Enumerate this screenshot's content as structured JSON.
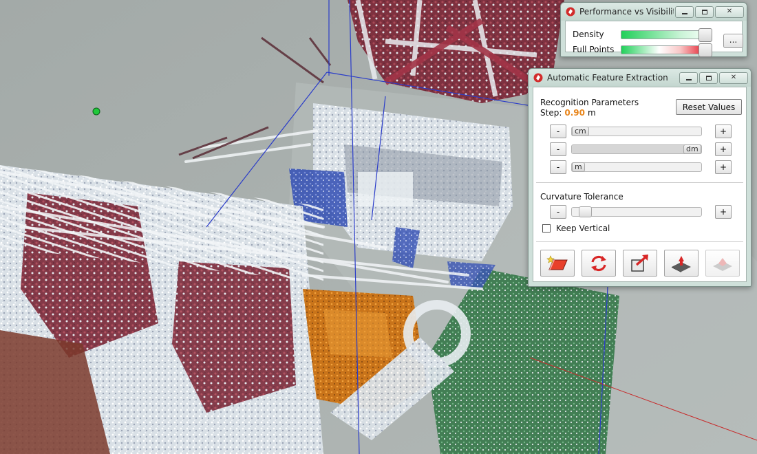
{
  "scene": {
    "description_icons": [
      "point-cloud-scan"
    ]
  },
  "perf_window": {
    "title": "Performance vs Visibility",
    "density_label": "Density",
    "density_level": 1.0,
    "full_points_label": "Full Points",
    "full_points_level": 1.0,
    "more_label": "..."
  },
  "afe_window": {
    "title": "Automatic Feature Extraction",
    "recognition_title": "Recognition Parameters",
    "step_label": "Step:",
    "step_value": "0.90",
    "step_unit": "m",
    "reset_label": "Reset Values",
    "minus_label": "-",
    "plus_label": "+",
    "sliders": [
      {
        "unit": "cm",
        "level": 0.0
      },
      {
        "unit": "dm",
        "level": 1.0
      },
      {
        "unit": "m",
        "level": 0.0
      }
    ],
    "curvature_title": "Curvature Tolerance",
    "curvature_level": 0.06,
    "keep_vertical_label": "Keep Vertical",
    "keep_vertical_checked": false,
    "tools": [
      "extract-plane-icon",
      "refresh-icon",
      "export-icon",
      "push-extrude-icon",
      "extrude-disabled-icon"
    ]
  },
  "colors": {
    "window_frame": "#cfe0da",
    "step_value": "#e8861d",
    "point_red": "#8a2a3a",
    "point_white": "#e8eef2",
    "point_orange": "#d9821d",
    "point_green": "#3f8a55",
    "point_blue": "#3d58b8"
  }
}
